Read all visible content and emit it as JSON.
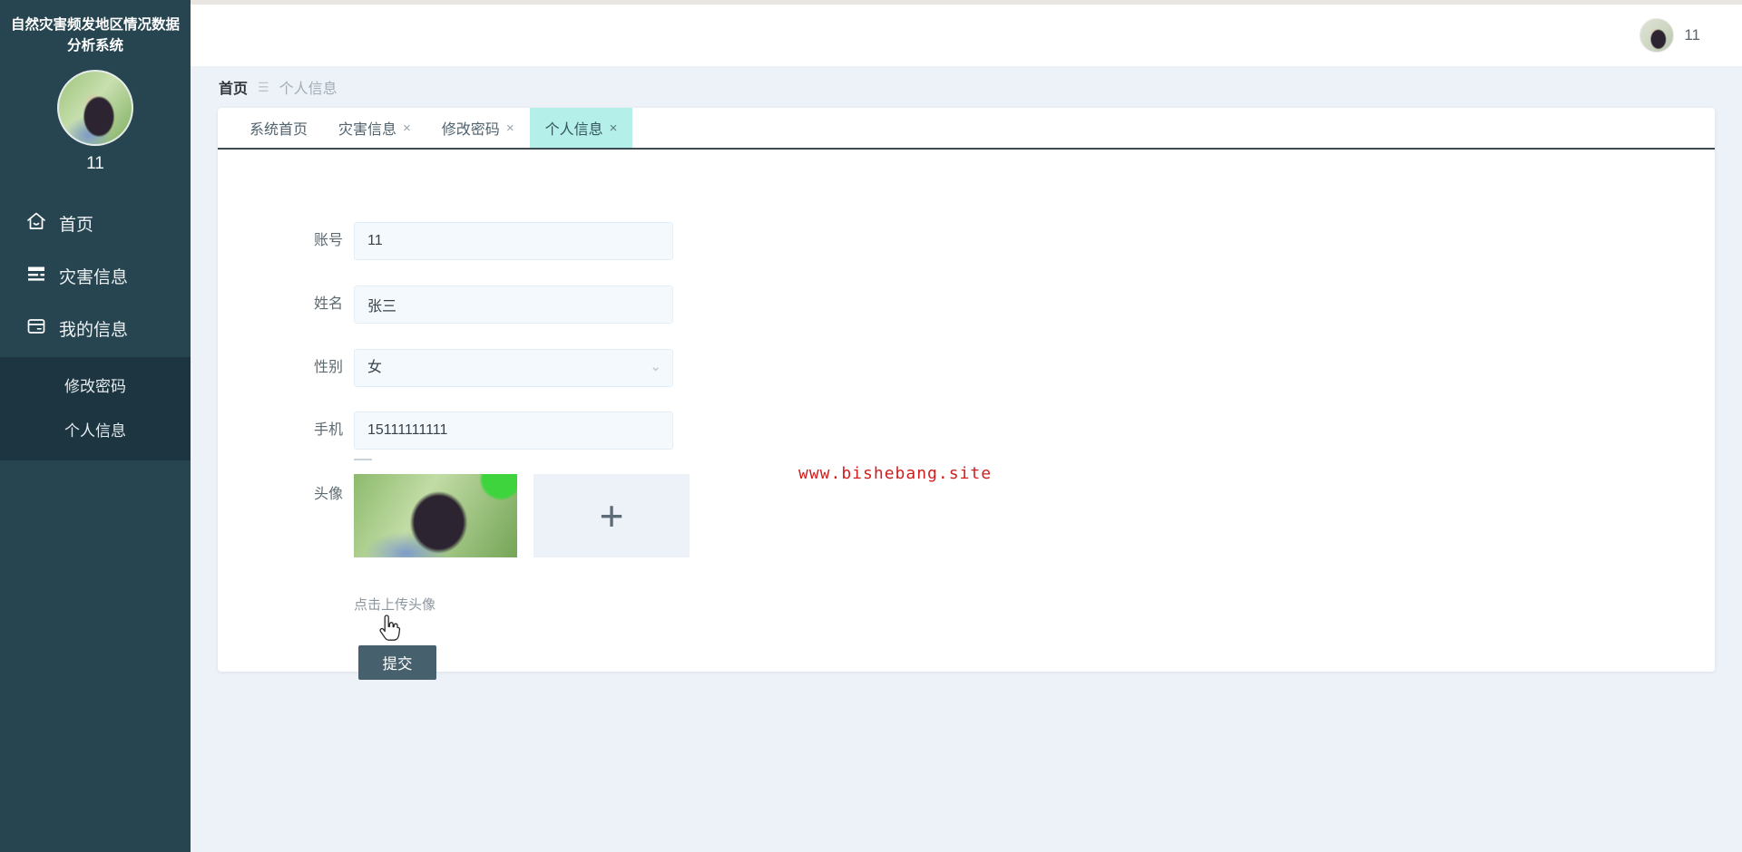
{
  "app": {
    "title": "自然灾害频发地区情况数据分析系统"
  },
  "sidebar": {
    "username": "11",
    "menu": [
      {
        "label": "首页",
        "icon": "home-icon"
      },
      {
        "label": "灾害信息",
        "icon": "list-icon"
      },
      {
        "label": "我的信息",
        "icon": "card-icon"
      }
    ],
    "submenu": [
      {
        "label": "修改密码"
      },
      {
        "label": "个人信息"
      }
    ]
  },
  "header": {
    "username": "11"
  },
  "breadcrumb": {
    "home": "首页",
    "current": "个人信息"
  },
  "tabs": [
    {
      "label": "系统首页",
      "closable": false,
      "active": false
    },
    {
      "label": "灾害信息",
      "closable": true,
      "active": false
    },
    {
      "label": "修改密码",
      "closable": true,
      "active": false
    },
    {
      "label": "个人信息",
      "closable": true,
      "active": true
    }
  ],
  "form": {
    "fields": [
      {
        "label": "账号",
        "value": "11",
        "type": "text"
      },
      {
        "label": "姓名",
        "value": "张三",
        "type": "text"
      },
      {
        "label": "性别",
        "value": "女",
        "type": "select"
      },
      {
        "label": "手机",
        "value": "15111111111",
        "type": "text"
      }
    ],
    "avatar_label": "头像",
    "upload_hint": "点击上传头像",
    "submit_label": "提交"
  },
  "watermark": {
    "text": "www.bishebang.site",
    "color": "#cf1f1f"
  },
  "icons": {
    "breadcrumb_separator": "☰",
    "close": "×",
    "chevron_down": "⌄",
    "plus": "+"
  },
  "colors": {
    "sidebar_bg": "#274550",
    "submenu_bg": "#1d3540",
    "content_bg": "#ecf2f8",
    "active_tab_bg": "#b4efe9",
    "tabbar_border": "#3d4a52",
    "submit_bg": "#46606d",
    "input_bg": "#f3f9fd",
    "watermark_red": "#cf1f1f"
  }
}
